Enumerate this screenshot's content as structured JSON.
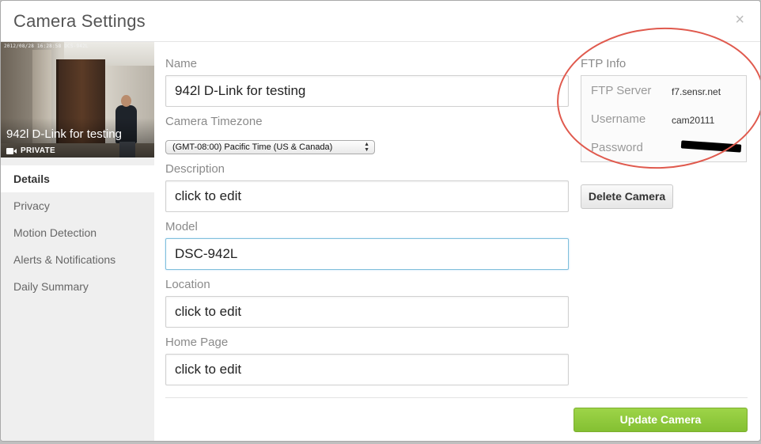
{
  "dialog": {
    "title": "Camera Settings",
    "close_glyph": "×"
  },
  "thumbnail": {
    "timestamp": "2012/08/28 16:28:58 DCS-942L",
    "camera_name": "942l D-Link for testing",
    "privacy_badge": "PRIVATE",
    "badge_icon": "video-camera-icon"
  },
  "sidebar": {
    "items": [
      {
        "label": "Details"
      },
      {
        "label": "Privacy"
      },
      {
        "label": "Motion Detection"
      },
      {
        "label": "Alerts & Notifications"
      },
      {
        "label": "Daily Summary"
      }
    ],
    "active_index": 0
  },
  "form": {
    "name_label": "Name",
    "name_value": "942l D-Link for testing",
    "timezone_label": "Camera Timezone",
    "timezone_value": "(GMT-08:00) Pacific Time (US & Canada)",
    "description_label": "Description",
    "description_value": "click to edit",
    "model_label": "Model",
    "model_value": "DSC-942L",
    "location_label": "Location",
    "location_value": "click to edit",
    "homepage_label": "Home Page",
    "homepage_value": "click to edit"
  },
  "ftp": {
    "title": "FTP Info",
    "server_label": "FTP Server",
    "server_value": "f7.sensr.net",
    "username_label": "Username",
    "username_value": "cam20111",
    "password_label": "Password"
  },
  "actions": {
    "delete_label": "Delete Camera",
    "update_label": "Update Camera"
  },
  "colors": {
    "update_button": "#8cc63f",
    "annotation_circle": "#e05a4e",
    "sidebar_bg": "#efefef"
  }
}
